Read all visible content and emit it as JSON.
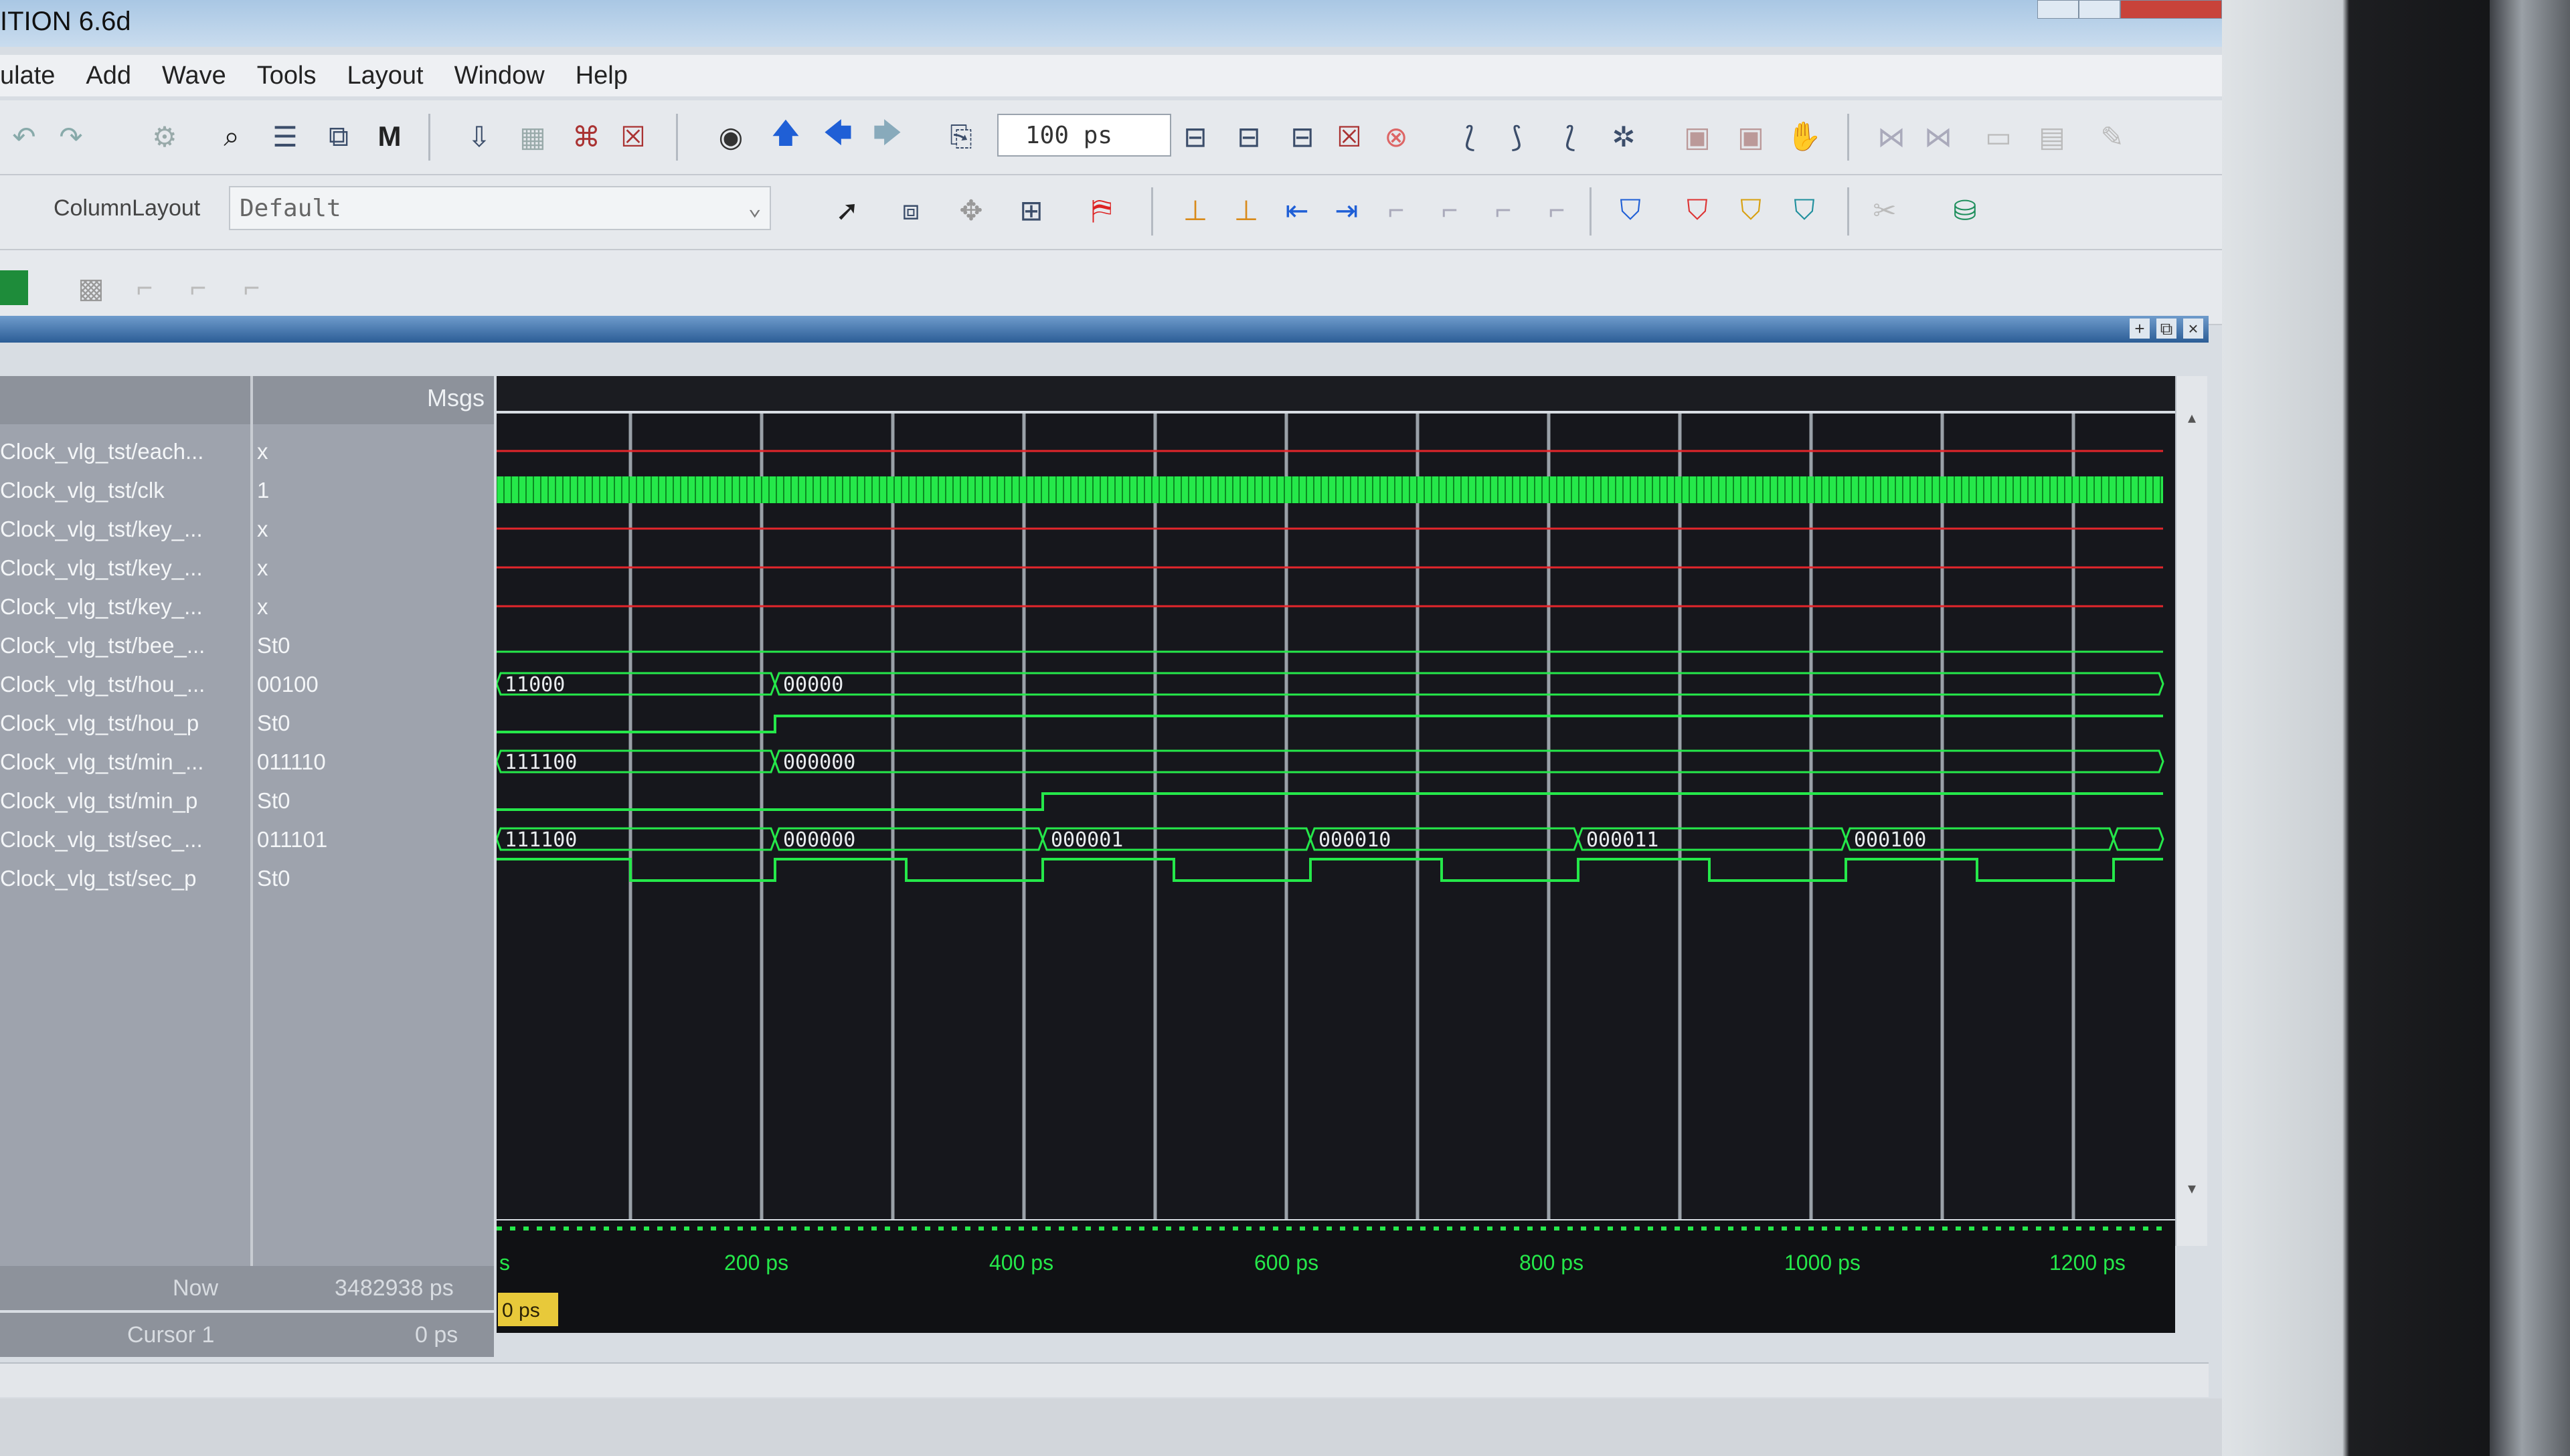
{
  "window": {
    "title": "ITION 6.6d"
  },
  "menu": [
    "ulate",
    "Add",
    "Wave",
    "Tools",
    "Layout",
    "Window",
    "Help"
  ],
  "toolbar": {
    "zoom_value": "100 ps",
    "column_layout_label": "ColumnLayout",
    "column_layout_value": "Default"
  },
  "icons": [
    "undo-icon",
    "redo-icon",
    "find-binoculars-icon",
    "run-icon",
    "up-arrow-icon",
    "left-arrow-icon",
    "right-arrow-icon",
    "zoom-icon",
    "cursor-select-icon",
    "zoom-box-icon",
    "traffic-light-icon",
    "add-cursor-icon"
  ],
  "wave_panel": {
    "msgs_header": "Msgs",
    "signals": [
      {
        "name": "Clock_vlg_tst/each...",
        "value": "x",
        "kind": "bit",
        "state": "x"
      },
      {
        "name": "Clock_vlg_tst/clk",
        "value": "1",
        "kind": "clock"
      },
      {
        "name": "Clock_vlg_tst/key_...",
        "value": "x",
        "kind": "bit",
        "state": "x"
      },
      {
        "name": "Clock_vlg_tst/key_...",
        "value": "x",
        "kind": "bit",
        "state": "x"
      },
      {
        "name": "Clock_vlg_tst/key_...",
        "value": "x",
        "kind": "bit",
        "state": "x"
      },
      {
        "name": "Clock_vlg_tst/bee_...",
        "value": "St0",
        "kind": "bit",
        "state": "low"
      },
      {
        "name": "Clock_vlg_tst/hou_...",
        "value": "00100",
        "kind": "bus",
        "labels": [
          "11000",
          "00000"
        ]
      },
      {
        "name": "Clock_vlg_tst/hou_p",
        "value": "St0",
        "kind": "bit",
        "state": "pulse1"
      },
      {
        "name": "Clock_vlg_tst/min_...",
        "value": "011110",
        "kind": "bus",
        "labels": [
          "111100",
          "000000"
        ]
      },
      {
        "name": "Clock_vlg_tst/min_p",
        "value": "St0",
        "kind": "bit",
        "state": "pulse2"
      },
      {
        "name": "Clock_vlg_tst/sec_...",
        "value": "011101",
        "kind": "bus",
        "labels": [
          "111100",
          "000000",
          "000001",
          "000010",
          "000011",
          "000100"
        ]
      },
      {
        "name": "Clock_vlg_tst/sec_p",
        "value": "St0",
        "kind": "bit",
        "state": "square"
      }
    ],
    "now_label": "Now",
    "now_value": "3482938 ps",
    "cursor_label": "Cursor 1",
    "cursor_value": "0 ps",
    "cursor_tag": "0 ps",
    "timeline_labels": [
      "s",
      "200 ps",
      "400 ps",
      "600 ps",
      "800 ps",
      "1000 ps",
      "1200 ps"
    ]
  },
  "colors": {
    "wave_bg": "#16171c",
    "x_state": "#e3262b",
    "signal": "#25e84a",
    "grid": "#9aa1a8",
    "cursor": "#e8c93a"
  }
}
